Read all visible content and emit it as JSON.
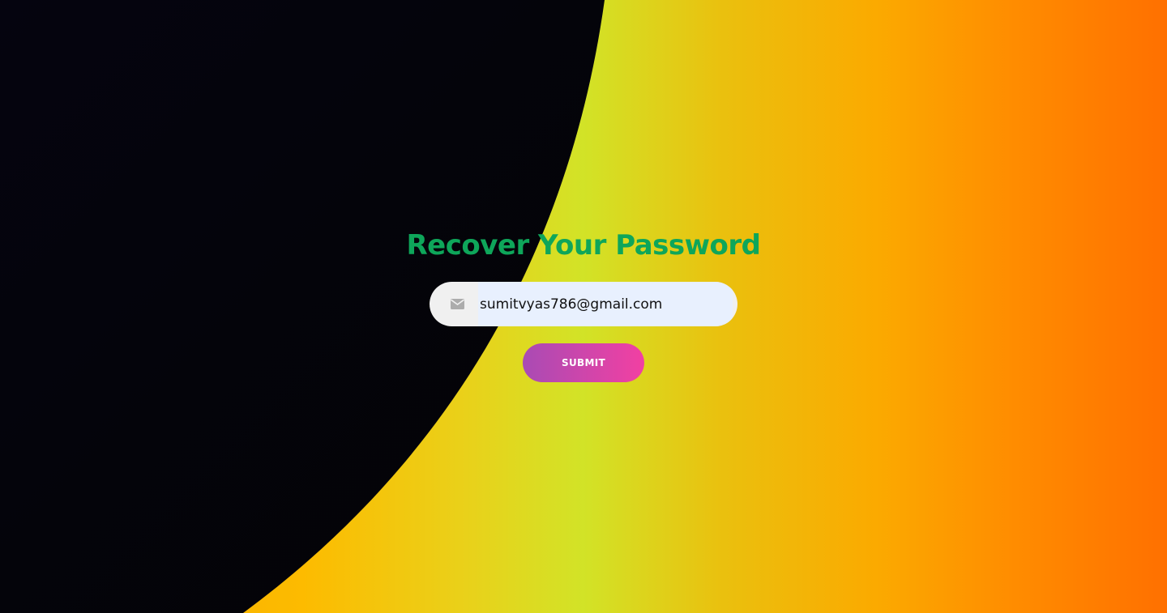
{
  "colors": {
    "title": "#0ea65a",
    "dark_panel": "#05040f",
    "input_background": "#f0f0f0",
    "autofill_background": "#e8f0fe",
    "icon": "#acacac",
    "button_start": "#a94bb4",
    "button_end": "#f240a2",
    "gradient_left": "#fdbb00",
    "gradient_middle": "#d2e327",
    "gradient_right": "#ff7000"
  },
  "form": {
    "title": "Recover Your Password",
    "email_icon": "envelope-icon",
    "email_value": "sumitvyas786@gmail.com",
    "submit_label": "SUBMIT"
  }
}
